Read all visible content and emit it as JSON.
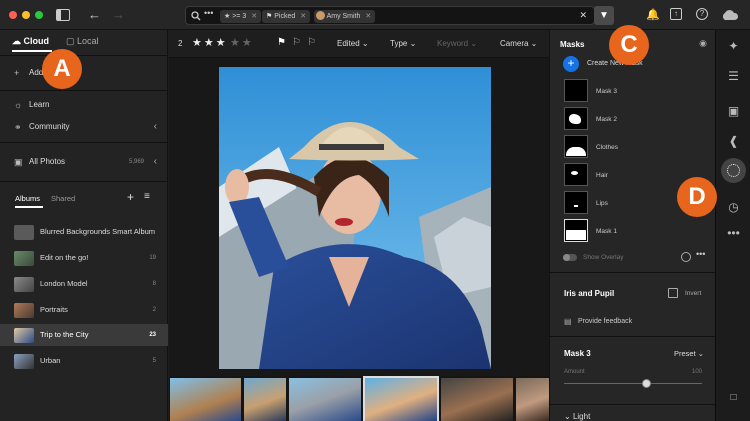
{
  "window_controls": {
    "close": "#ff5f57",
    "minimize": "#febc2e",
    "maximize": "#28c840"
  },
  "search": {
    "rating_filter": "★ >= 3",
    "flag_filter": "Picked",
    "person_filter": "Amy Smith"
  },
  "left_panel": {
    "tab_cloud": "Cloud",
    "tab_local": "Local",
    "add_label": "Add Photos",
    "learn": "Learn",
    "community": "Community",
    "all_photos": "All Photos",
    "all_photos_count": "5,969",
    "tab_albums": "Albums",
    "tab_shared": "Shared",
    "albums": [
      {
        "name": "Blurred Backgrounds Smart Album",
        "count": ""
      },
      {
        "name": "Edit on the go!",
        "count": "19"
      },
      {
        "name": "London Model",
        "count": "8"
      },
      {
        "name": "Portraits",
        "count": "2"
      },
      {
        "name": "Trip to the City",
        "count": "23"
      },
      {
        "name": "Urban",
        "count": "5"
      }
    ]
  },
  "toolbar": {
    "count": "2",
    "stars": "★★★",
    "stars_empty": "★★",
    "edited": "Edited",
    "type": "Type",
    "keyword": "Keyword",
    "camera": "Camera"
  },
  "masks_panel": {
    "title": "Masks",
    "create_label": "Create New Mask",
    "masks": [
      "Mask 3",
      "Mask 2",
      "Clothes",
      "Hair",
      "Lips",
      "Mask 1"
    ],
    "show_overlay": "Show Overlay",
    "iris_title": "Iris and Pupil",
    "invert": "Invert",
    "feedback": "Provide feedback",
    "mask3_title": "Mask 3",
    "preset": "Preset",
    "amount_label": "Amount",
    "amount_value": "100",
    "amount_level": 0.6,
    "light": "Light"
  },
  "callouts": {
    "a": "A",
    "c": "C",
    "d": "D"
  },
  "colors": {
    "accent": "#e8651e",
    "selection": "#3a3a3a",
    "blue": "#1473e6"
  }
}
